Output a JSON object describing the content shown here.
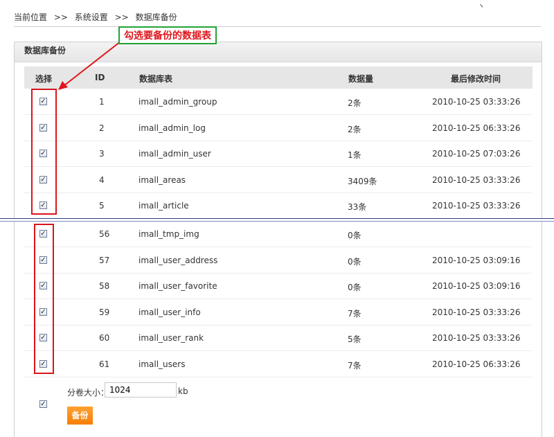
{
  "breadcrumb": {
    "items": [
      "当前位置",
      "系统设置",
      "数据库备份"
    ],
    "separator": ">>"
  },
  "panel": {
    "title": "数据库备份"
  },
  "annotation": {
    "callout_text": "勾选要备份的数据表",
    "colors": {
      "box": "#d8141b",
      "callout_border": "#21a333",
      "callout_text": "#e0161d"
    }
  },
  "table": {
    "headers": {
      "select": "选择",
      "id": "ID",
      "table": "数据库表",
      "count": "数据量",
      "modified": "最后修改时间"
    },
    "rows_top": [
      {
        "checked": true,
        "id": "1",
        "name": "imall_admin_group",
        "count": "2条",
        "modified": "2010-10-25 03:33:26"
      },
      {
        "checked": true,
        "id": "2",
        "name": "imall_admin_log",
        "count": "2条",
        "modified": "2010-10-25 06:33:26"
      },
      {
        "checked": true,
        "id": "3",
        "name": "imall_admin_user",
        "count": "1条",
        "modified": "2010-10-25 07:03:26"
      },
      {
        "checked": true,
        "id": "4",
        "name": "imall_areas",
        "count": "3409条",
        "modified": "2010-10-25 03:33:26"
      },
      {
        "checked": true,
        "id": "5",
        "name": "imall_article",
        "count": "33条",
        "modified": "2010-10-25 03:33:26"
      }
    ],
    "rows_bottom": [
      {
        "checked": true,
        "id": "56",
        "name": "imall_tmp_img",
        "count": "0条",
        "modified": ""
      },
      {
        "checked": true,
        "id": "57",
        "name": "imall_user_address",
        "count": "0条",
        "modified": "2010-10-25 03:09:16"
      },
      {
        "checked": true,
        "id": "58",
        "name": "imall_user_favorite",
        "count": "0条",
        "modified": "2010-10-25 03:09:16"
      },
      {
        "checked": true,
        "id": "59",
        "name": "imall_user_info",
        "count": "7条",
        "modified": "2010-10-25 03:33:26"
      },
      {
        "checked": true,
        "id": "60",
        "name": "imall_user_rank",
        "count": "5条",
        "modified": "2010-10-25 03:33:26"
      },
      {
        "checked": true,
        "id": "61",
        "name": "imall_users",
        "count": "7条",
        "modified": "2010-10-25 06:33:26"
      }
    ]
  },
  "footer": {
    "volume_label": "分卷大小：",
    "volume_value": "1024",
    "volume_unit": "kb",
    "select_all_checked": true,
    "backup_button": "备份",
    "button_color": "#f57e06"
  },
  "icons": {
    "checkbox": "checkbox-checked-icon",
    "arrow": "red-arrow-icon"
  }
}
